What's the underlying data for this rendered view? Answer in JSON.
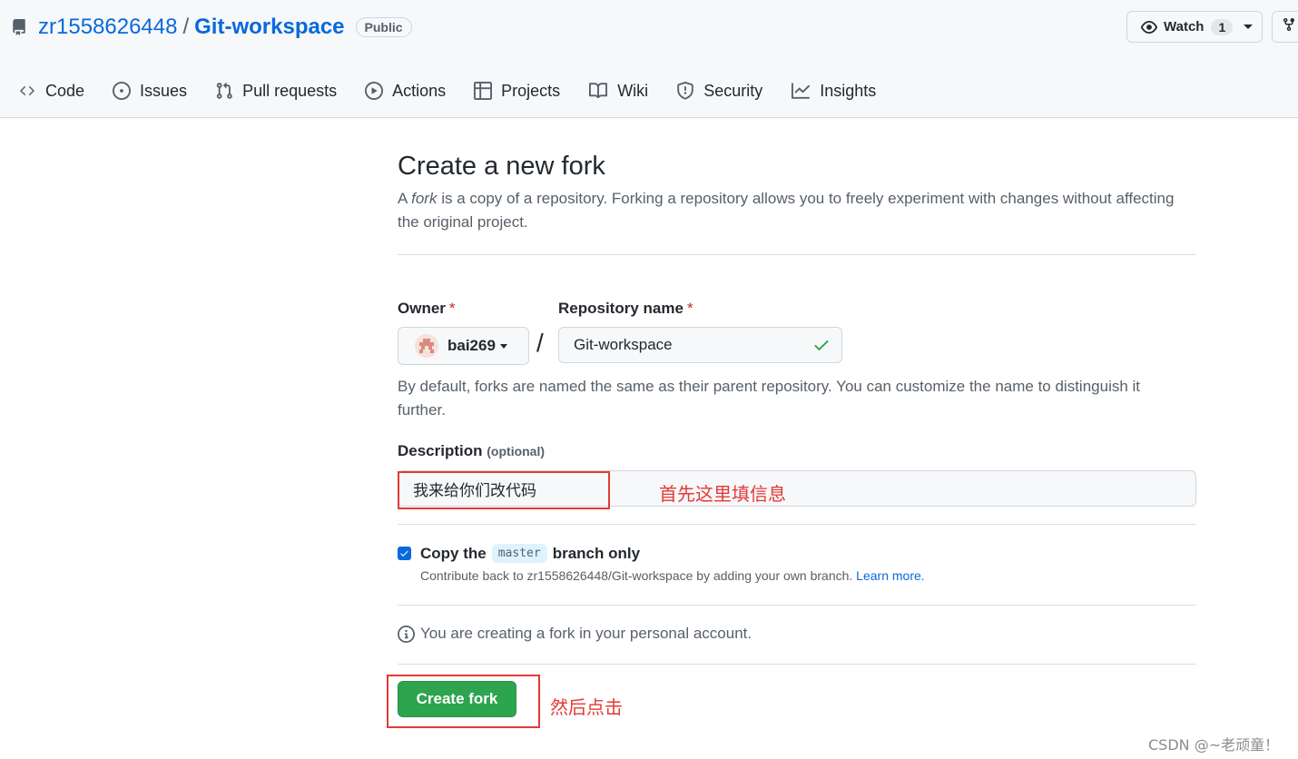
{
  "header": {
    "owner": "zr1558626448",
    "separator": "/",
    "repo": "Git-workspace",
    "visibility_badge": "Public",
    "watch_label": "Watch",
    "watch_count": "1"
  },
  "nav": {
    "items": [
      {
        "label": "Code",
        "icon": "code-icon"
      },
      {
        "label": "Issues",
        "icon": "issue-icon"
      },
      {
        "label": "Pull requests",
        "icon": "pull-request-icon"
      },
      {
        "label": "Actions",
        "icon": "play-icon"
      },
      {
        "label": "Projects",
        "icon": "table-icon"
      },
      {
        "label": "Wiki",
        "icon": "book-icon"
      },
      {
        "label": "Security",
        "icon": "shield-icon"
      },
      {
        "label": "Insights",
        "icon": "graph-icon"
      }
    ]
  },
  "form": {
    "title": "Create a new fork",
    "desc_prefix": "A ",
    "desc_em": "fork",
    "desc_suffix": " is a copy of a repository. Forking a repository allows you to freely experiment with changes without affecting the original project.",
    "owner_label": "Owner",
    "required_mark": "*",
    "owner_value": "bai269",
    "slash": "/",
    "repo_name_label": "Repository name",
    "repo_name_value": "Git-workspace",
    "naming_hint": "By default, forks are named the same as their parent repository. You can customize the name to distinguish it further.",
    "description_label": "Description",
    "description_optional": "(optional)",
    "description_value": "我来给你们改代码",
    "copy_prefix": "Copy the",
    "copy_branch": "master",
    "copy_suffix": "branch only",
    "copy_checked": true,
    "copy_sub_text": "Contribute back to zr1558626448/Git-workspace by adding your own branch.",
    "learn_more": "Learn more.",
    "info_text": "You are creating a fork in your personal account.",
    "create_button": "Create fork"
  },
  "annotations": {
    "fill_info": "首先这里填信息",
    "then_click": "然后点击"
  },
  "colors": {
    "link": "#0969da",
    "primary_button": "#2da44e",
    "annotation_red": "#e53935",
    "required_red": "#cf222e"
  },
  "watermark": "CSDN @~老顽童！"
}
